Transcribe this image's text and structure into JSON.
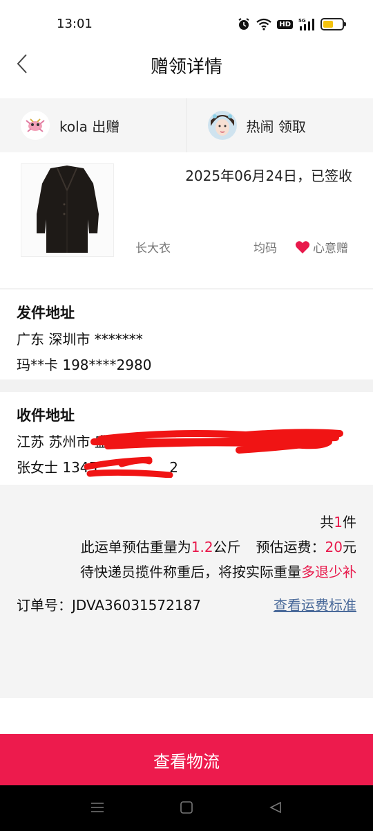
{
  "status_bar": {
    "time": "13:01",
    "icons": [
      "alarm-icon",
      "wifi-icon",
      "hd-icon",
      "signal-5g-icon",
      "battery-icon"
    ],
    "hd_label": "HD",
    "battery_color": "#f4c20d"
  },
  "nav": {
    "title": "赠领详情",
    "back_icon": "chevron-left-icon"
  },
  "users": {
    "giver": "kola 出赠",
    "receiver": "热闹 领取"
  },
  "item": {
    "status": "2025年06月24日，已签收",
    "name": "长大衣",
    "size": "均码",
    "tag": "心意赠",
    "tag_color": "#e8194b"
  },
  "sender": {
    "title": "发件地址",
    "address": "广东 深圳市 *******",
    "contact": "玛**卡 198****2980"
  },
  "receiver_addr": {
    "title": "收件地址",
    "address": "江苏 苏州市 盛",
    "contact": "张女士 1345",
    "contact_tail": "2"
  },
  "order": {
    "count_prefix": "共",
    "count": "1",
    "count_suffix": "件",
    "weight_prefix": "此运单预估重量为",
    "weight": "1.2",
    "weight_unit": "公斤",
    "fee_label": "预估运费：",
    "fee": "20",
    "fee_unit": "元",
    "note_prefix": "待快递员揽件称重后，将按实际重量",
    "note_highlight": "多退少补",
    "order_no": "订单号：JDVA36031572187",
    "fee_link": "查看运费标准"
  },
  "bottom_button": "查看物流",
  "accent_color": "#ed1b4d"
}
